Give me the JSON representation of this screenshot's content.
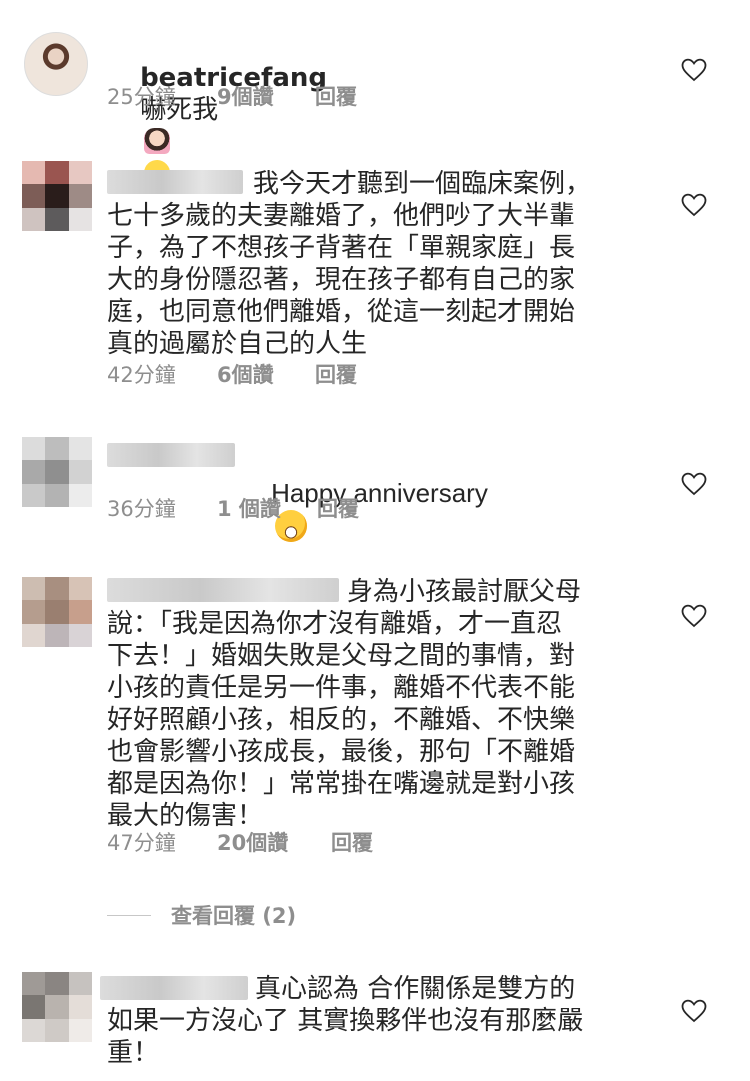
{
  "comments": [
    {
      "username": "beatricefang",
      "text": "嚇死我",
      "time": "25分鐘",
      "likes": "9個讚",
      "reply": "回覆",
      "emojis": [
        "woman-tipping-hand-emoji",
        "rofl-emoji"
      ]
    },
    {
      "username": "",
      "text": "我今天才聽到一個臨床案例，\n七十多歲的夫妻離婚了，他們吵了大半輩\n子，為了不想孩子背著在「單親家庭」長\n大的身份隱忍著，現在孩子都有自己的家\n庭，也同意他們離婚，從這一刻起才開始\n真的過屬於自己的人生",
      "time": "42分鐘",
      "likes": "6個讚",
      "reply": "回覆"
    },
    {
      "username": "",
      "text": "Happy anniversary",
      "time": "36分鐘",
      "likes": "1 個讚",
      "reply": "回覆",
      "emojis": [
        "grinning-sweat-emoji"
      ]
    },
    {
      "username": "",
      "text": "身為小孩最討厭父母\n說：「我是因為你才沒有離婚，才一直忍\n下去！」婚姻失敗是父母之間的事情，對\n小孩的責任是另一件事，離婚不代表不能\n好好照顧小孩，相反的，不離婚、不快樂\n也會影響小孩成長，最後，那句「不離婚\n都是因為你！」常常掛在嘴邊就是對小孩\n最大的傷害！",
      "time": "47分鐘",
      "likes": "20個讚",
      "reply": "回覆",
      "view_replies": "查看回覆 (2)"
    },
    {
      "username": "",
      "text": "真心認為 合作關係是雙方的\n如果一方沒心了 其實換夥伴也沒有那麼嚴\n重！"
    }
  ]
}
